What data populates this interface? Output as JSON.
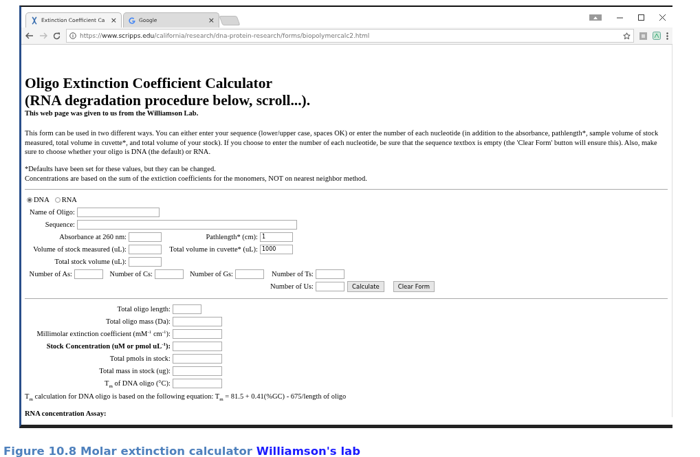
{
  "browser": {
    "tabs": [
      {
        "title": "Extinction Coefficient Ca",
        "close": "×",
        "selected": true
      },
      {
        "title": "Google",
        "close": "×",
        "selected": false
      }
    ],
    "url": {
      "scheme": "https://",
      "host": "www.scripps.edu",
      "path": "/california/research/dna-protein-research/forms/biopolymercalc2.html"
    }
  },
  "page": {
    "title_lines": [
      "Oligo Extinction Coefficient Calculator",
      "(RNA degradation procedure below, scroll...)."
    ],
    "subtitle": "This web page was given to us from the Williamson Lab.",
    "intro": "This form can be used in two different ways. You can either enter your sequence (lower/upper case, spaces OK) or enter the number of each nucleotide (in addition to the absorbance, pathlength*, sample volume of stock measured, total volume in cuvette*, and total volume of your stock). If you choose to enter the number of each nucleotide, be sure that the sequence textbox is empty (the 'Clear Form' button will ensure this). Also, make sure to choose whether your oligo is DNA (the default) or RNA.",
    "notes": [
      "*Defaults have been set for these values, but they can be changed.",
      "Concentrations are based on the sum of the extiction coefficients for the monomers, NOT on nearest neighbor method."
    ],
    "radios": [
      {
        "label": "DNA",
        "selected": true
      },
      {
        "label": "RNA",
        "selected": false
      }
    ],
    "fields": [
      {
        "label": "Name of Oligo:"
      },
      {
        "label": "Sequence:"
      },
      {
        "label": "Absorbance at 260 nm:"
      },
      {
        "label": "Pathlength* (cm):",
        "value": "1"
      },
      {
        "label": "Volume of stock measured (uL):"
      },
      {
        "label": "Total volume in cuvette* (uL):",
        "value": "1000"
      },
      {
        "label": "Total stock volume (uL):"
      },
      {
        "label": "Number of As:"
      },
      {
        "label": "Number of Cs:"
      },
      {
        "label": "Number of Gs:"
      },
      {
        "label": "Number of Ts:"
      },
      {
        "label": "Number of Us:"
      }
    ],
    "buttons": [
      "Calculate",
      "Clear Form"
    ],
    "results": [
      {
        "label": "Total oligo length:",
        "emphasis": false
      },
      {
        "label": "Total oligo mass (Da):",
        "emphasis": false
      },
      {
        "label": "Millimolar extinction coefficient (mM$^{-1}$ cm$^{-1}$):",
        "emphasis": false
      },
      {
        "label": "Stock Concentration (uM or pmol uL$^{-1}$):",
        "emphasis": true
      },
      {
        "label": "Total pmols in stock:",
        "emphasis": false
      },
      {
        "label": "Total mass in stock (ug):",
        "emphasis": false
      },
      {
        "label": "T$_{m}$ of DNA oligo (°C):",
        "emphasis": false
      }
    ],
    "equation": "T$_{m}$ calculation for DNA oligo is based on the following equation: T$_{m}$ = 81.5 + 0.41(%GC) - 675/length of oligo",
    "section_heading": "RNA concentration Assay:"
  },
  "caption": {
    "text": "Figure 10.8 Molar extinction calculator",
    "link": "Williamson's lab"
  }
}
